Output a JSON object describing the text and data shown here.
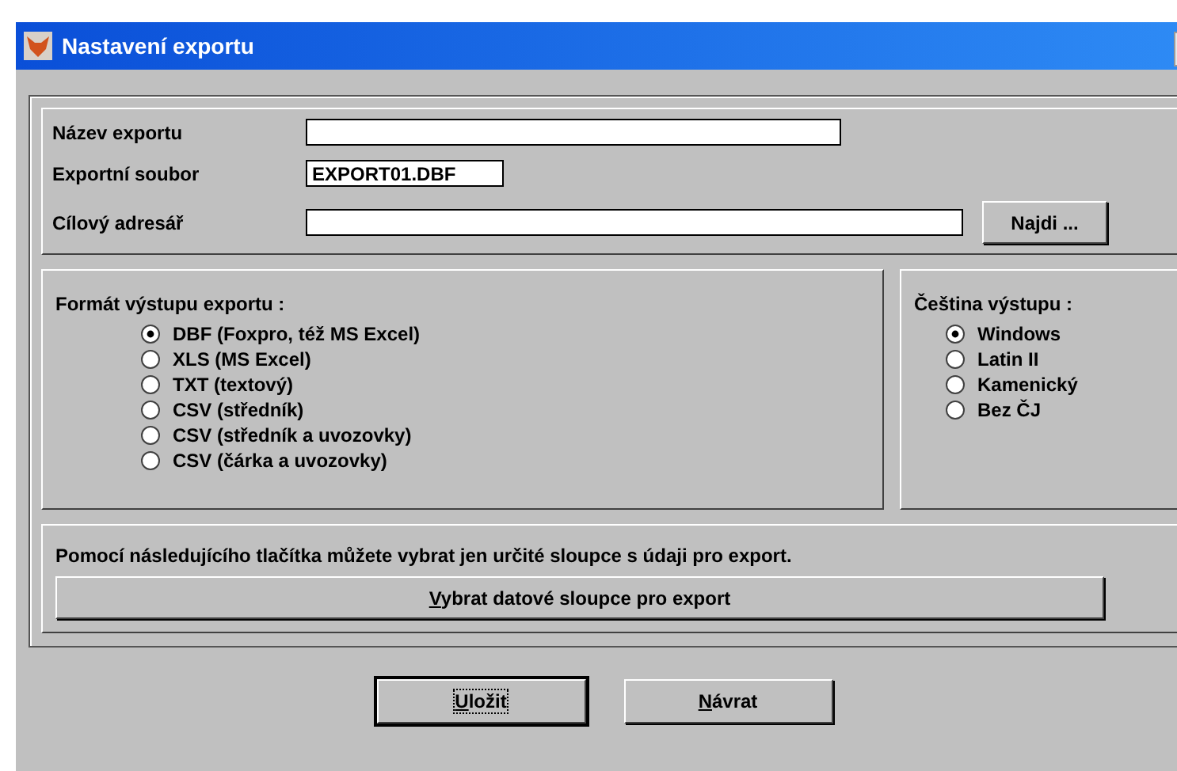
{
  "window": {
    "title": "Nastavení exportu"
  },
  "fields": [
    {
      "label": "Název exportu",
      "kind": "long"
    },
    {
      "label": "Exportní soubor",
      "value": "EXPORT01.DBF",
      "kind": "short"
    },
    {
      "label": "Cílový adresář",
      "kind": "browse",
      "button": "Najdi ..."
    }
  ],
  "format": {
    "title": "Formát výstupu exportu :",
    "options": [
      {
        "label": "DBF (Foxpro, též MS Excel)",
        "selected": true
      },
      {
        "label": "XLS (MS Excel)",
        "selected": false
      },
      {
        "label": "TXT (textový)",
        "selected": false
      },
      {
        "label": "CSV (středník)",
        "selected": false
      },
      {
        "label": "CSV (středník a uvozovky)",
        "selected": false
      },
      {
        "label": "CSV (čárka a uvozovky)",
        "selected": false
      }
    ]
  },
  "encoding": {
    "title": "Čeština výstupu :",
    "options": [
      {
        "label": "Windows",
        "selected": true
      },
      {
        "label": "Latin II",
        "selected": false
      },
      {
        "label": "Kamenický",
        "selected": false
      },
      {
        "label": "Bez ČJ",
        "selected": false
      }
    ]
  },
  "columns": {
    "hint": "Pomocí následujícího tlačítka můžete vybrat jen určité sloupce s údaji pro export.",
    "button": "Vybrat datové sloupce pro export"
  },
  "buttons": [
    {
      "label": "Uložit",
      "default": true
    },
    {
      "label": "Návrat",
      "default": false
    }
  ]
}
